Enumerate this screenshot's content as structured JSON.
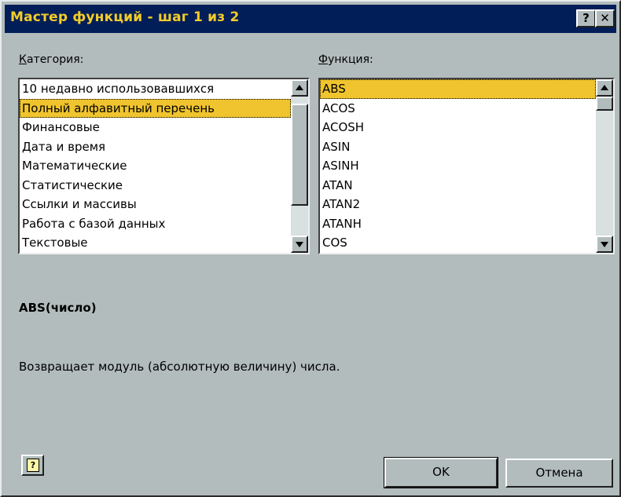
{
  "window": {
    "title": "Мастер функций - шаг 1 из 2",
    "help_glyph": "?",
    "close_glyph": "✕"
  },
  "category": {
    "label_accel": "К",
    "label_rest": "атегория:",
    "items": [
      "10 недавно использовавшихся",
      "Полный алфавитный перечень",
      "Финансовые",
      "Дата и время",
      "Математические",
      "Статистические",
      "Ссылки и массивы",
      "Работа с базой данных",
      "Текстовые"
    ],
    "selected_index": 1,
    "scroll_position": 0.2
  },
  "function": {
    "label_accel": "Ф",
    "label_rest": "ункция:",
    "items": [
      "ABS",
      "ACOS",
      "ACOSH",
      "ASIN",
      "ASINH",
      "ATAN",
      "ATAN2",
      "ATANH",
      "COS"
    ],
    "selected_index": 0,
    "scroll_position": 0.0
  },
  "description": {
    "syntax": "ABS(число)",
    "text": "Возвращает модуль (абсолютную величину) числа."
  },
  "buttons": {
    "ok": "OK",
    "cancel": "Отмена",
    "help_icon": "?"
  },
  "colors": {
    "titlebar": "#021e58",
    "title_text": "#f3cc28",
    "selection": "#f0c42e",
    "dialog_bg": "#b2bcbc"
  }
}
